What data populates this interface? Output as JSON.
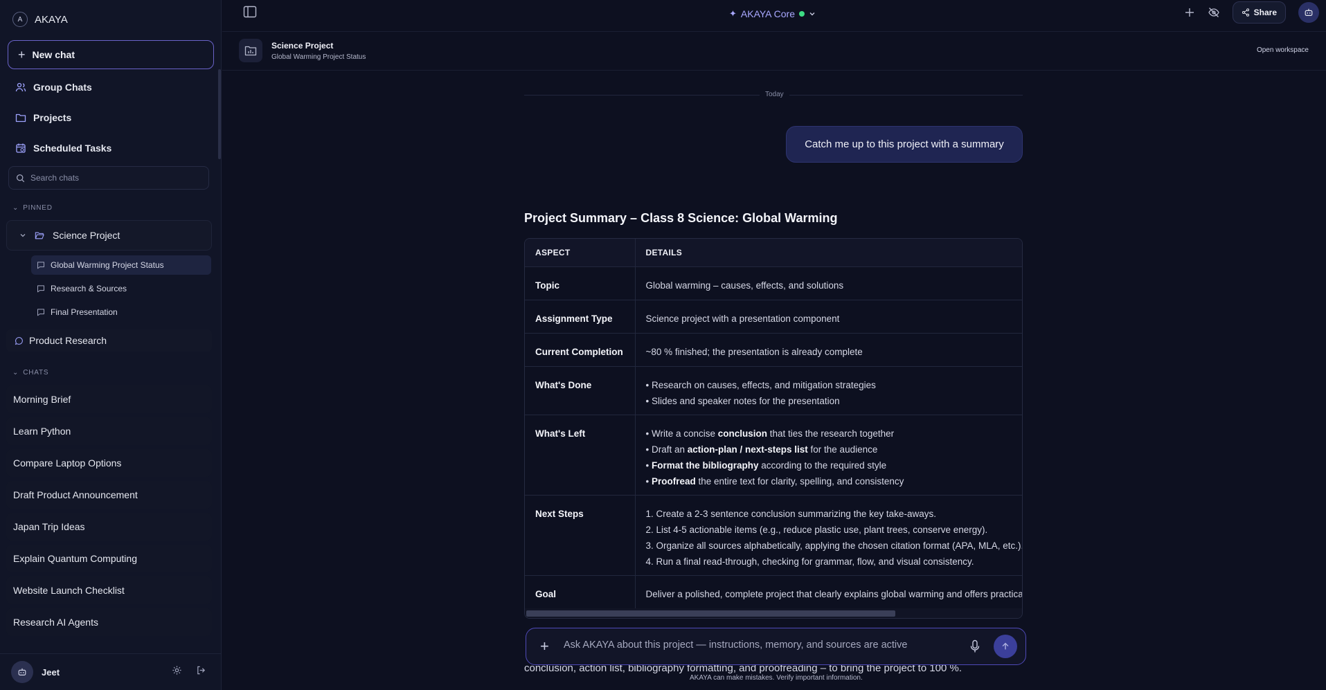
{
  "app": {
    "name": "AKAYA",
    "logo_letter": "A"
  },
  "sidebar": {
    "new_chat": "New chat",
    "nav": [
      {
        "label": "Group Chats",
        "icon": "users-icon"
      },
      {
        "label": "Projects",
        "icon": "folder-icon"
      },
      {
        "label": "Scheduled Tasks",
        "icon": "calendar-icon"
      }
    ],
    "search_placeholder": "Search chats",
    "pinned_label": "PINNED",
    "pinned_project": {
      "name": "Science Project",
      "chats": [
        {
          "label": "Global Warming Project Status",
          "active": true
        },
        {
          "label": "Research & Sources",
          "active": false
        },
        {
          "label": "Final Presentation",
          "active": false
        }
      ]
    },
    "pinned_chat": "Product Research",
    "chats_label": "CHATS",
    "chats": [
      "Morning Brief",
      "Learn Python",
      "Compare Laptop Options",
      "Draft Product Announcement",
      "Japan Trip Ideas",
      "Explain Quantum Computing",
      "Website Launch Checklist",
      "Research AI Agents"
    ],
    "user": {
      "name": "Jeet"
    }
  },
  "topbar": {
    "model_name": "AKAYA Core",
    "share_label": "Share"
  },
  "project_header": {
    "title": "Science Project",
    "subtitle": "Global Warming Project Status",
    "open_workspace": "Open workspace"
  },
  "conversation": {
    "date_divider": "Today",
    "user_message": "Catch me up to this project with a summary",
    "summary_title": "Project Summary – Class 8 Science: Global Warming",
    "table": {
      "headers": [
        "ASPECT",
        "DETAILS"
      ],
      "rows": [
        {
          "aspect": "Topic",
          "details": [
            "Global warming – causes, effects, and solutions"
          ]
        },
        {
          "aspect": "Assignment Type",
          "details": [
            "Science project with a presentation component"
          ]
        },
        {
          "aspect": "Current Completion",
          "details": [
            "~80 % finished; the presentation is already complete"
          ]
        },
        {
          "aspect": "What's Done",
          "details": [
            "• Research on causes, effects, and mitigation strategies",
            "• Slides and speaker notes for the presentation"
          ]
        },
        {
          "aspect": "What's Left",
          "details": [
            [
              "• Write a concise ",
              "conclusion",
              " that ties the research together"
            ],
            [
              "• Draft an ",
              "action-plan / next-steps list",
              " for the audience"
            ],
            [
              "• ",
              "Format the bibliography",
              " according to the required style"
            ],
            [
              "• ",
              "Proofread",
              " the entire text for clarity, spelling, and consistency"
            ]
          ]
        },
        {
          "aspect": "Next Steps",
          "details": [
            "1. Create a 2-3 sentence conclusion summarizing the key take-aways.",
            "2. List 4-5 actionable items (e.g., reduce plastic use, plant trees, conserve energy).",
            "3. Organize all sources alphabetically, applying the chosen citation format (APA, MLA, etc.).",
            "4. Run a final read-through, checking for grammar, flow, and visual consistency."
          ]
        },
        {
          "aspect": "Goal",
          "details": [
            "Deliver a polished, complete project that clearly explains global warming and offers practical solutions."
          ]
        }
      ]
    },
    "partial_text": "conclusion, action list, bibliography formatting, and proofreading – to bring the project to 100 %."
  },
  "composer": {
    "placeholder": "Ask AKAYA about this project — instructions, memory, and sources are active",
    "disclaimer": "AKAYA can make mistakes. Verify important information."
  },
  "colors": {
    "accent": "#6a63c9",
    "model": "#a9a8ff",
    "status": "#3ddc84",
    "background": "#0d1020"
  }
}
